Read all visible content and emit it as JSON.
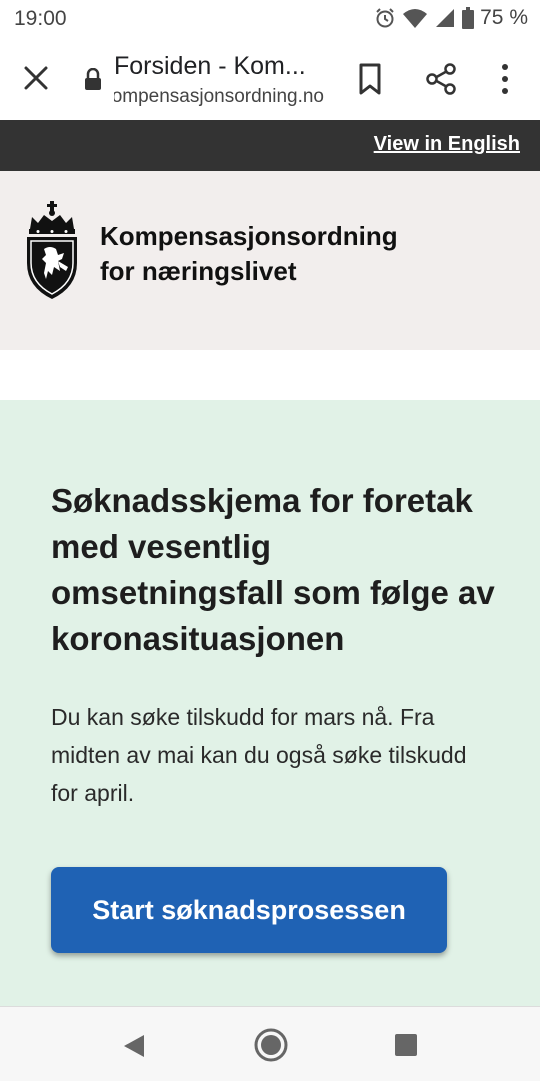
{
  "status_bar": {
    "time": "19:00",
    "battery": "75 %",
    "icons": [
      "alarm-icon",
      "wifi-icon",
      "signal-icon",
      "battery-icon"
    ]
  },
  "browser": {
    "page_title": "Forsiden - Kom...",
    "url": "kompensasjonsordning.no",
    "icons": [
      "close-icon",
      "lock-icon",
      "bookmark-icon",
      "share-icon",
      "more-vert-icon"
    ]
  },
  "language_bar": {
    "link_label": "View in English"
  },
  "header": {
    "name_line1": "Kompensasjonsordning",
    "name_line2": "for næringslivet",
    "logo": "norwegian-coat-of-arms"
  },
  "hero": {
    "title": "Søknadsskjema for foretak med vesentlig omsetningsfall som følge av koronasituasjonen",
    "body": "Du kan søke tilskudd for mars nå. Fra midten av mai kan du også søke tilskudd for april.",
    "button_label": "Start søknadsprosessen"
  },
  "nav_bar": {
    "icons": [
      "back-icon",
      "home-icon",
      "recent-apps-icon"
    ]
  },
  "colors": {
    "language_bar": "#333333",
    "header_bg": "#f2eeed",
    "hero_bg": "#e1f2e7",
    "button": "#1f62b4"
  }
}
